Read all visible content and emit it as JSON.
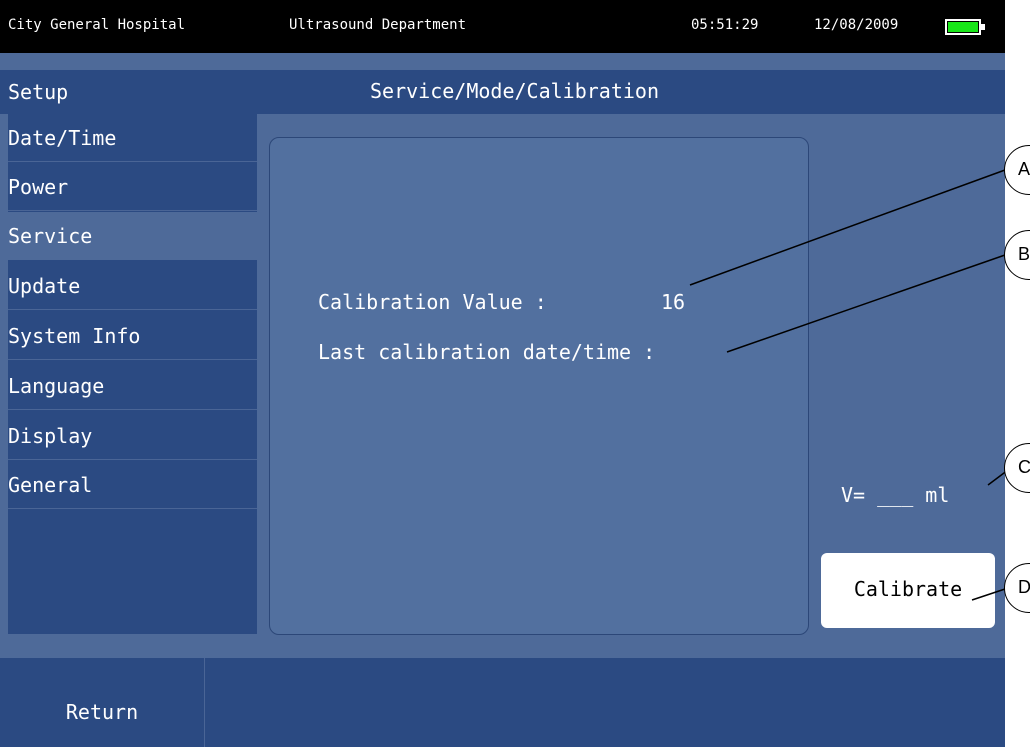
{
  "status_bar": {
    "hospital": "City General Hospital",
    "department": "Ultrasound Department",
    "time": "05:51:29",
    "date": "12/08/2009",
    "battery_icon": "battery-full-icon",
    "battery_color": "#19e619"
  },
  "header": {
    "section": "Setup",
    "title": "Service/Mode/Calibration"
  },
  "sidebar": {
    "items": [
      {
        "label": "Date/Time",
        "active": false
      },
      {
        "label": "Power",
        "active": false
      },
      {
        "label": "Service",
        "active": true
      },
      {
        "label": "Update",
        "active": false
      },
      {
        "label": "System Info",
        "active": false
      },
      {
        "label": "Language",
        "active": false
      },
      {
        "label": "Display",
        "active": false
      },
      {
        "label": "General",
        "active": false
      }
    ]
  },
  "main": {
    "calibration_value_label": "Calibration Value :",
    "calibration_value": "16",
    "last_calibration_label": "Last calibration date/time :",
    "volume_text": "V= ___ ml",
    "calibrate_label": "Calibrate"
  },
  "footer": {
    "return_label": "Return"
  },
  "callouts": [
    "A",
    "B",
    "C",
    "D"
  ],
  "colors": {
    "background": "#4e6a99",
    "panel": "#2b4a82",
    "status_bar": "#000000"
  }
}
